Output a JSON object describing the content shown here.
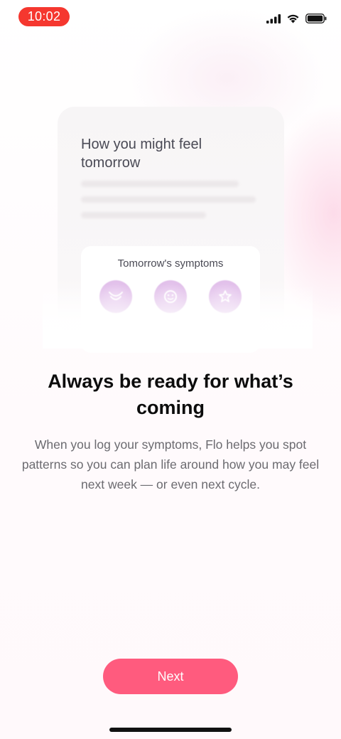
{
  "status_bar": {
    "time": "10:02",
    "icons": [
      "cellular-signal-icon",
      "wifi-icon",
      "battery-icon"
    ],
    "time_pill_color": "#f5372f"
  },
  "preview_card": {
    "title": "How you might feel tomorrow",
    "symptoms_card": {
      "title": "Tomorrow's symptoms",
      "symptom_icons": [
        "cramps-icon",
        "mood-icon",
        "acne-icon"
      ]
    }
  },
  "onboarding": {
    "headline": "Always be ready for what’s coming",
    "description": "When you log your symptoms, Flo helps you spot patterns so you can plan life around how you may feel next week — or even next cycle."
  },
  "actions": {
    "next_label": "Next",
    "accent_color": "#ff5b7e"
  }
}
